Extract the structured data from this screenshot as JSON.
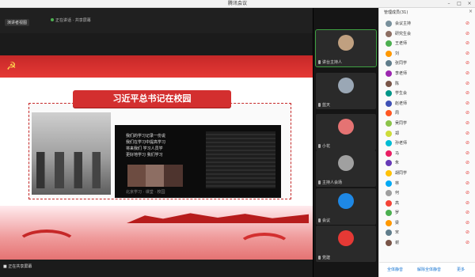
{
  "window": {
    "title": "腾讯会议",
    "controls": [
      "–",
      "□",
      "×"
    ]
  },
  "meeting": {
    "tag": "演讲者视图",
    "status_text": "正在讲话 · 共享屏幕"
  },
  "slide": {
    "banner": "习近平总书记在校园",
    "screen_lines": [
      "我们的学习记录一份说",
      "我们在学习中提高学习",
      "将来我们 学习人员学",
      "更好地学习 我们学习"
    ],
    "screen_caption": "北京学习 · 课堂 · 校园"
  },
  "stage": {
    "status_text": "■ 正在共享屏幕"
  },
  "video_tiles": [
    {
      "name": "讲台主持人",
      "avatar_color": "#c0a080",
      "active": true
    },
    {
      "name": "蓝天",
      "avatar_color": "#9aa7b5"
    },
    {
      "name": "小花",
      "avatar_color": "#e57373"
    },
    {
      "name": "主持人会场",
      "avatar_color": "#a0a0a0"
    },
    {
      "name": "会议",
      "avatar_color": "#1e88e5"
    },
    {
      "name": "党建",
      "avatar_color": "#e53935"
    }
  ],
  "participants": {
    "title": "管理成员(31)",
    "rows": [
      {
        "name": "会议主持",
        "color": "#78909c"
      },
      {
        "name": "研究生会",
        "color": "#8d6e63"
      },
      {
        "name": "王老师",
        "color": "#4caf50"
      },
      {
        "name": "刘",
        "color": "#ff9800"
      },
      {
        "name": "张同学",
        "color": "#607d8b"
      },
      {
        "name": "李老师",
        "color": "#9c27b0"
      },
      {
        "name": "陈",
        "color": "#795548"
      },
      {
        "name": "学生会",
        "color": "#009688"
      },
      {
        "name": "赵老师",
        "color": "#3f51b5"
      },
      {
        "name": "周",
        "color": "#ff5722"
      },
      {
        "name": "吴同学",
        "color": "#8bc34a"
      },
      {
        "name": "郑",
        "color": "#cddc39"
      },
      {
        "name": "孙老师",
        "color": "#00bcd4"
      },
      {
        "name": "马",
        "color": "#e91e63"
      },
      {
        "name": "朱",
        "color": "#673ab7"
      },
      {
        "name": "胡同学",
        "color": "#ffc107"
      },
      {
        "name": "林",
        "color": "#03a9f4"
      },
      {
        "name": "何",
        "color": "#9e9e9e"
      },
      {
        "name": "高",
        "color": "#f44336"
      },
      {
        "name": "罗",
        "color": "#4caf50"
      },
      {
        "name": "梁",
        "color": "#ff9800"
      },
      {
        "name": "宋",
        "color": "#607d8b"
      },
      {
        "name": "谢",
        "color": "#795548"
      }
    ],
    "footer": [
      "全体静音",
      "解除全体静音",
      "更多"
    ]
  }
}
